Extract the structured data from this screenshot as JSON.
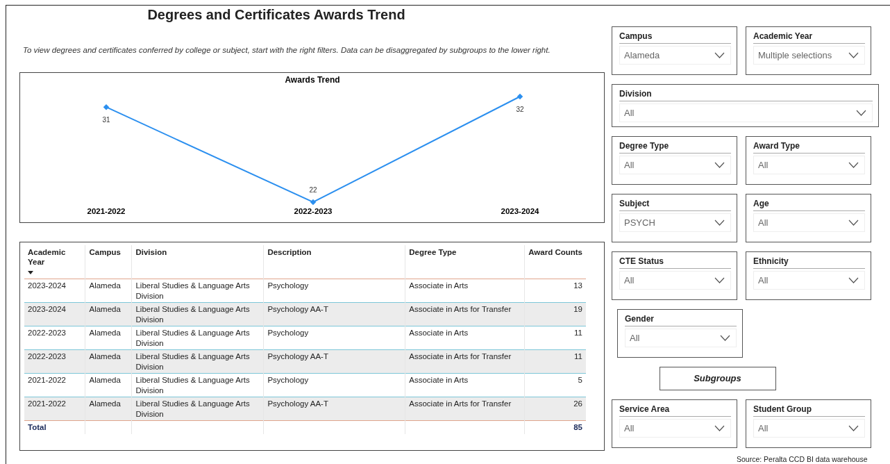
{
  "title": "Degrees and Certificates Awards Trend",
  "subtitle": "To view degrees and certificates conferred by college or subject, start with the right filters. Data can be disaggregated by subgroups to the lower right.",
  "chart": {
    "chart_data": {
      "type": "line",
      "title": "Awards Trend",
      "categories": [
        "2021-2022",
        "2022-2023",
        "2023-2024"
      ],
      "series": [
        {
          "color": "#2b8fef",
          "marker": "diamond",
          "values": [
            31,
            22,
            32
          ]
        }
      ],
      "data_labels": true
    }
  },
  "table": {
    "columns": [
      {
        "label": "Academic Year",
        "sorted": true
      },
      {
        "label": "Campus",
        "sorted": false
      },
      {
        "label": "Division",
        "sorted": false
      },
      {
        "label": "Description",
        "sorted": false
      },
      {
        "label": "Degree Type",
        "sorted": false
      },
      {
        "label": "Award Counts",
        "sorted": false
      }
    ],
    "rows": [
      [
        "2023-2024",
        "Alameda",
        "Liberal Studies & Language Arts Division",
        "Psychology",
        "Associate in Arts",
        "13"
      ],
      [
        "2023-2024",
        "Alameda",
        "Liberal Studies & Language Arts Division",
        "Psychology AA-T",
        "Associate in Arts for Transfer",
        "19"
      ],
      [
        "2022-2023",
        "Alameda",
        "Liberal Studies & Language Arts Division",
        "Psychology",
        "Associate in Arts",
        "11"
      ],
      [
        "2022-2023",
        "Alameda",
        "Liberal Studies & Language Arts Division",
        "Psychology AA-T",
        "Associate in Arts for Transfer",
        "11"
      ],
      [
        "2021-2022",
        "Alameda",
        "Liberal Studies & Language Arts Division",
        "Psychology",
        "Associate in Arts",
        "5"
      ],
      [
        "2021-2022",
        "Alameda",
        "Liberal Studies & Language Arts Division",
        "Psychology AA-T",
        "Associate in Arts for Transfer",
        "26"
      ]
    ],
    "total": {
      "label": "Total",
      "value": "85"
    }
  },
  "filter_rows": [
    {
      "kind": "slicers",
      "slicers": [
        {
          "label": "Campus",
          "value": "Alameda"
        },
        {
          "label": "Academic Year",
          "value": "Multiple selections"
        }
      ]
    },
    {
      "kind": "slicers",
      "slicers": [
        {
          "label": "Division",
          "value": "All"
        }
      ]
    },
    {
      "kind": "slicers",
      "slicers": [
        {
          "label": "Degree Type",
          "value": "All"
        },
        {
          "label": "Award Type",
          "value": "All"
        }
      ]
    },
    {
      "kind": "slicers",
      "slicers": [
        {
          "label": "Subject",
          "value": "PSYCH"
        },
        {
          "label": "Age",
          "value": "All"
        }
      ]
    },
    {
      "kind": "slicers",
      "slicers": [
        {
          "label": "CTE Status",
          "value": "All"
        },
        {
          "label": "Ethnicity",
          "value": "All"
        }
      ]
    },
    {
      "kind": "slicers",
      "slicers": [
        {
          "label": "Gender",
          "value": "All"
        }
      ]
    },
    {
      "kind": "heading",
      "label": "Subgroups"
    },
    {
      "kind": "slicers",
      "slicers": [
        {
          "label": "Service Area",
          "value": "All"
        },
        {
          "label": "Student Group",
          "value": "All"
        }
      ]
    }
  ],
  "source": "Source: Peralta CCD BI data warehouse"
}
